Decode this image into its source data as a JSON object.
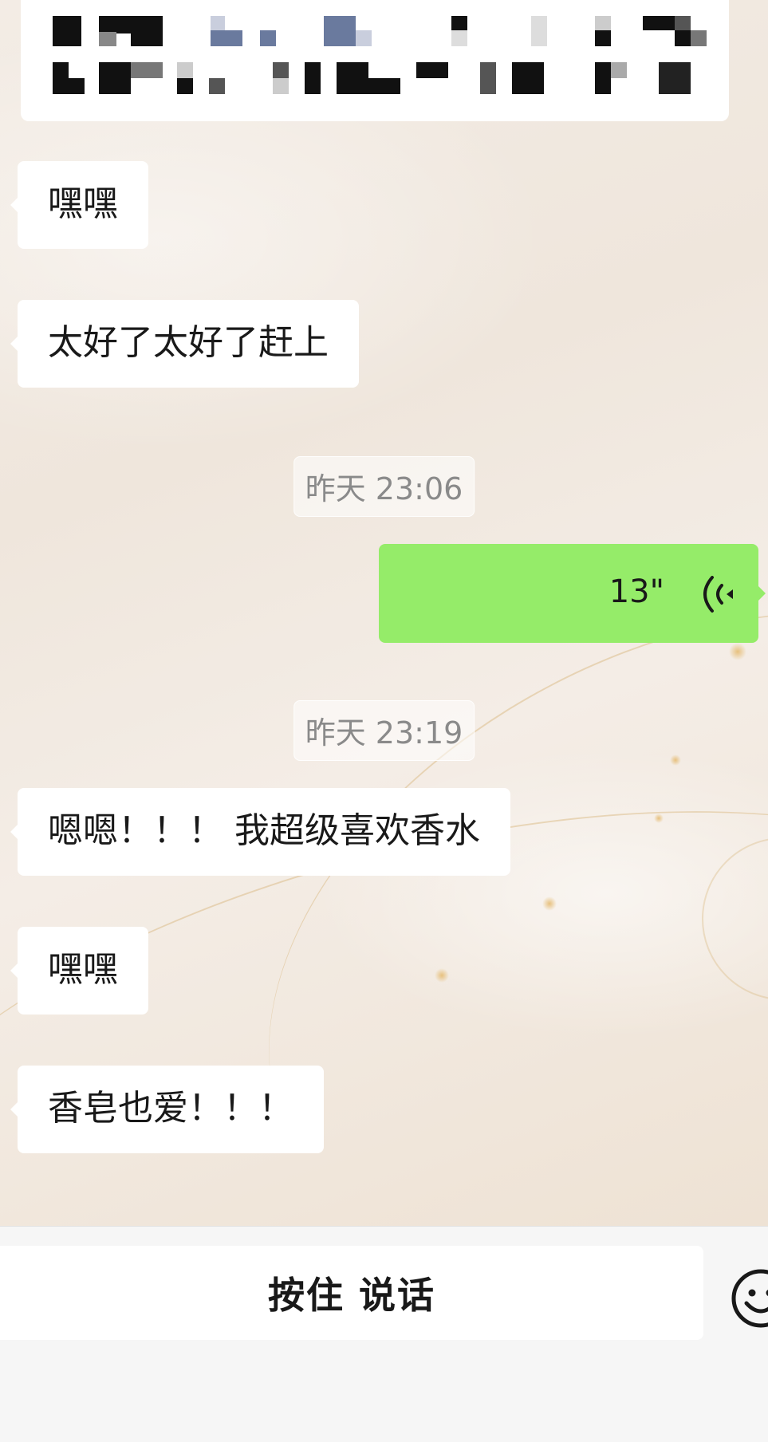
{
  "messages": {
    "m1": "嘿嘿",
    "m2": "太好了太好了赶上",
    "ts1": "昨天 23:06",
    "voice_duration": "13\"",
    "ts2": "昨天 23:19",
    "m3": "嗯嗯！！！ 我超级喜欢香水",
    "m4": "嘿嘿",
    "m5": "香皂也爱！！！"
  },
  "input_bar": {
    "hold_to_talk_label": "按住 说话"
  },
  "icons": {
    "voice": "voice-wave-icon",
    "emoji": "emoji-smile-icon"
  },
  "colors": {
    "outgoing_bubble": "#95ec69",
    "incoming_bubble": "#ffffff",
    "timestamp_text": "#8a8a8a"
  }
}
